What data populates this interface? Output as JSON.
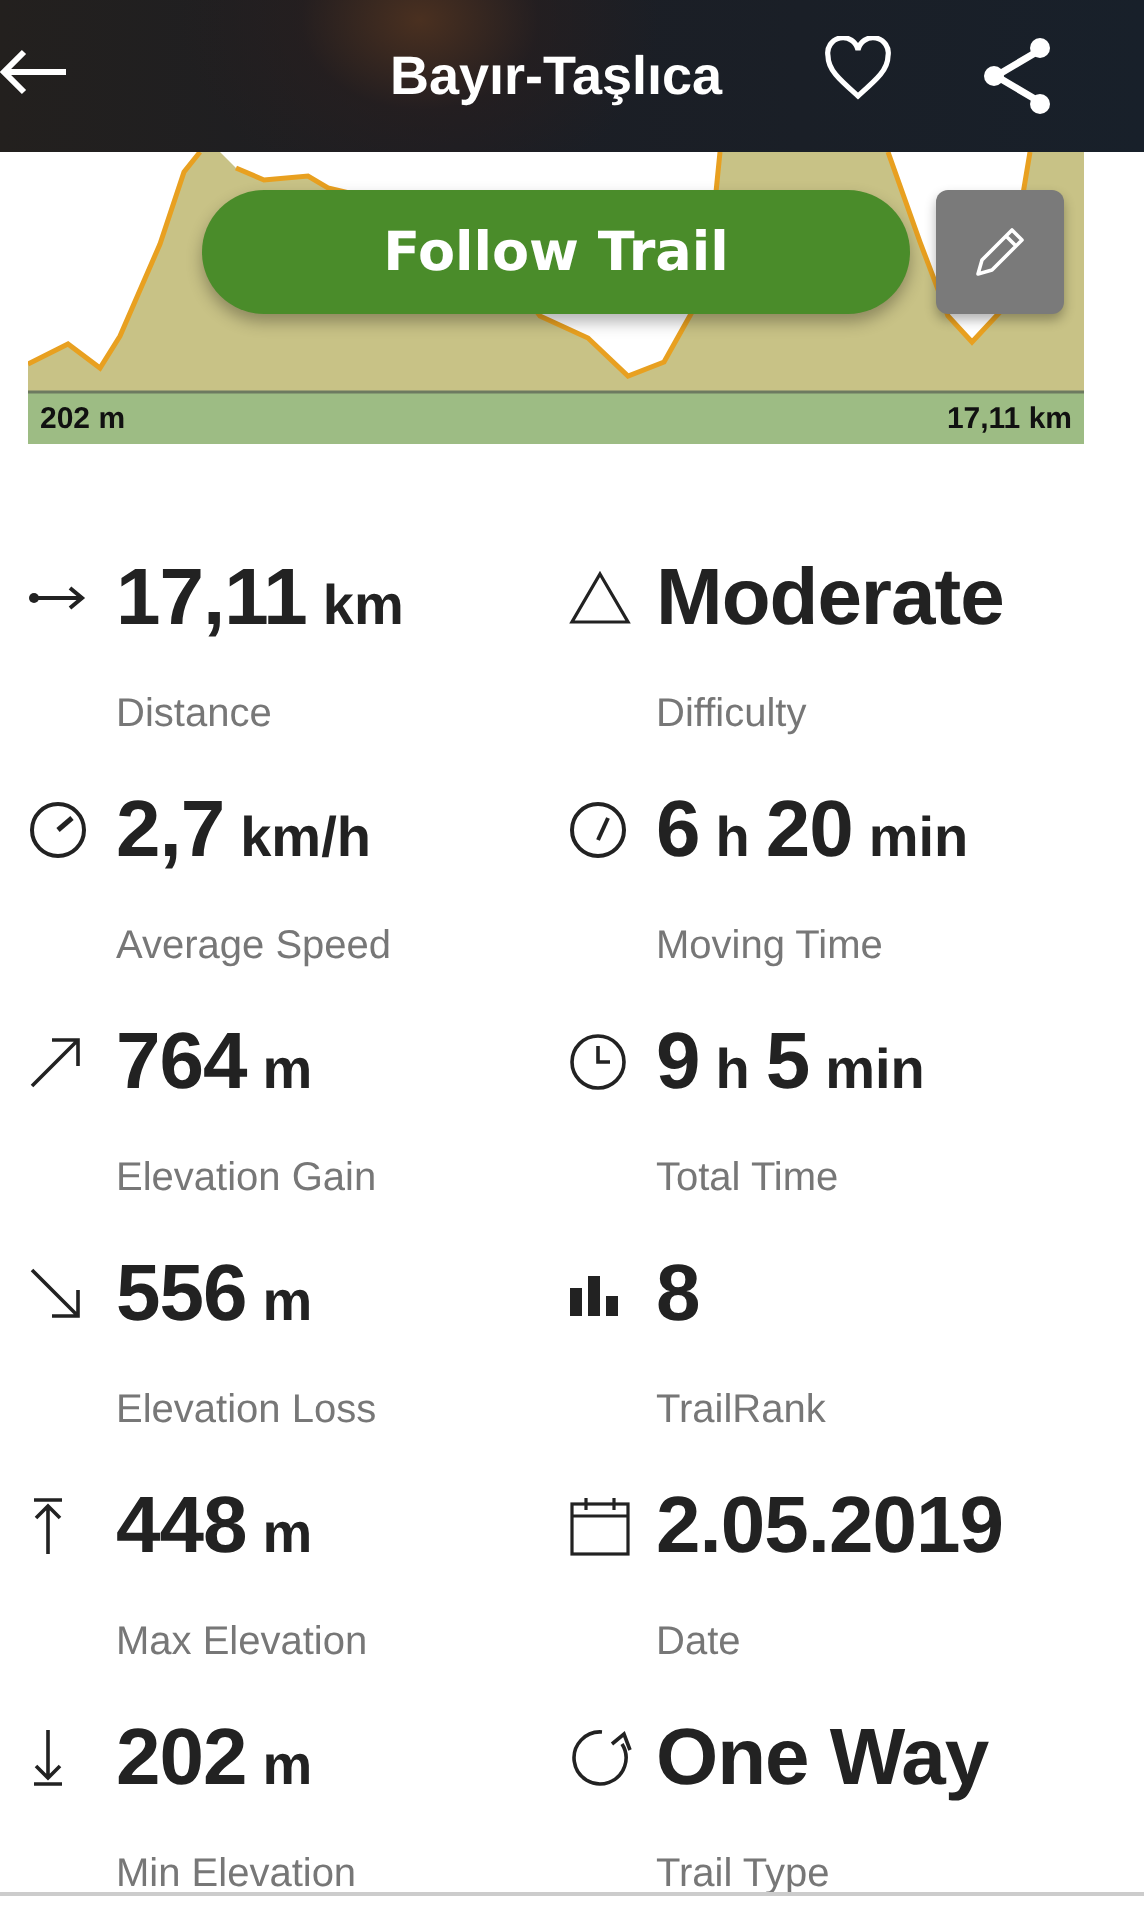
{
  "header": {
    "title": "Bayır-Taşlıca"
  },
  "profile": {
    "start_label": "202 m",
    "end_label": "17,11 km"
  },
  "follow_button": {
    "label": "Follow Trail"
  },
  "stats": [
    {
      "parts": [
        {
          "kind": "number",
          "text": "17,11"
        },
        {
          "kind": "unit",
          "text": "km"
        }
      ],
      "label": "Distance"
    },
    {
      "parts": [
        {
          "kind": "number",
          "text": "Moderate"
        }
      ],
      "label": "Difficulty"
    },
    {
      "parts": [
        {
          "kind": "number",
          "text": "2,7"
        },
        {
          "kind": "unit",
          "text": "km/h"
        }
      ],
      "label": "Average Speed"
    },
    {
      "parts": [
        {
          "kind": "number",
          "text": "6"
        },
        {
          "kind": "unit",
          "text": "h"
        },
        {
          "kind": "number",
          "text": "20"
        },
        {
          "kind": "unit",
          "text": "min"
        }
      ],
      "label": "Moving Time"
    },
    {
      "parts": [
        {
          "kind": "number",
          "text": "764"
        },
        {
          "kind": "unit",
          "text": "m"
        }
      ],
      "label": "Elevation Gain"
    },
    {
      "parts": [
        {
          "kind": "number",
          "text": "9"
        },
        {
          "kind": "unit",
          "text": "h"
        },
        {
          "kind": "number",
          "text": "5"
        },
        {
          "kind": "unit",
          "text": "min"
        }
      ],
      "label": "Total Time"
    },
    {
      "parts": [
        {
          "kind": "number",
          "text": "556"
        },
        {
          "kind": "unit",
          "text": "m"
        }
      ],
      "label": "Elevation Loss"
    },
    {
      "parts": [
        {
          "kind": "number",
          "text": "8"
        }
      ],
      "label": "TrailRank"
    },
    {
      "parts": [
        {
          "kind": "number",
          "text": "448"
        },
        {
          "kind": "unit",
          "text": "m"
        }
      ],
      "label": "Max Elevation"
    },
    {
      "parts": [
        {
          "kind": "number",
          "text": "2.05.2019"
        }
      ],
      "label": "Date"
    },
    {
      "parts": [
        {
          "kind": "number",
          "text": "202"
        },
        {
          "kind": "unit",
          "text": "m"
        }
      ],
      "label": "Min Elevation"
    },
    {
      "parts": [
        {
          "kind": "number",
          "text": "One Way"
        }
      ],
      "label": "Trail Type"
    }
  ]
}
